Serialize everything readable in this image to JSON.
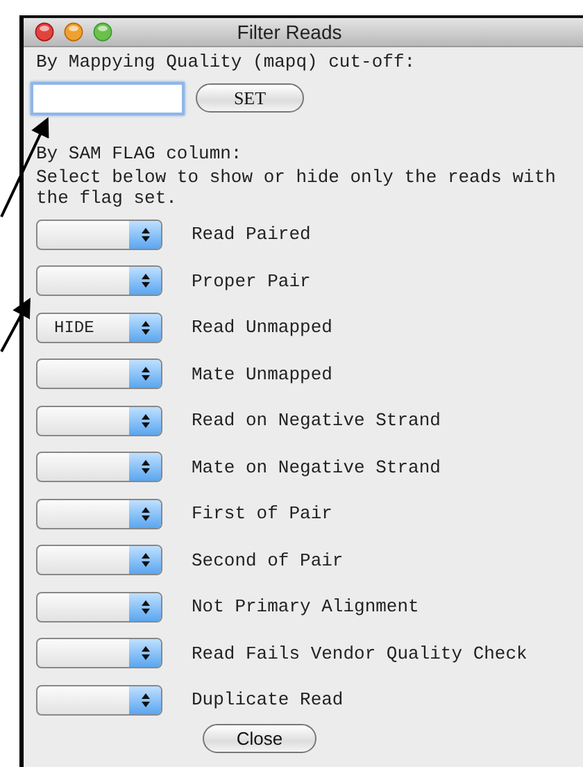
{
  "window": {
    "title": "Filter Reads"
  },
  "mapq": {
    "label": "By Mappying Quality (mapq) cut-off:",
    "button": "SET"
  },
  "flags": {
    "heading": "By SAM FLAG column:",
    "instructions": "Select below to show or hide only the reads with the flag set.",
    "items": [
      {
        "label": "Read Paired"
      },
      {
        "label": "Proper Pair"
      },
      {
        "label": "Read Unmapped",
        "value": "HIDE"
      },
      {
        "label": "Mate Unmapped"
      },
      {
        "label": "Read on Negative Strand"
      },
      {
        "label": "Mate on Negative Strand"
      },
      {
        "label": "First of Pair"
      },
      {
        "label": "Second of Pair"
      },
      {
        "label": "Not Primary Alignment"
      },
      {
        "label": "Read Fails Vendor Quality Check"
      },
      {
        "label": "Duplicate Read"
      }
    ]
  },
  "buttons": [
    "Close"
  ]
}
